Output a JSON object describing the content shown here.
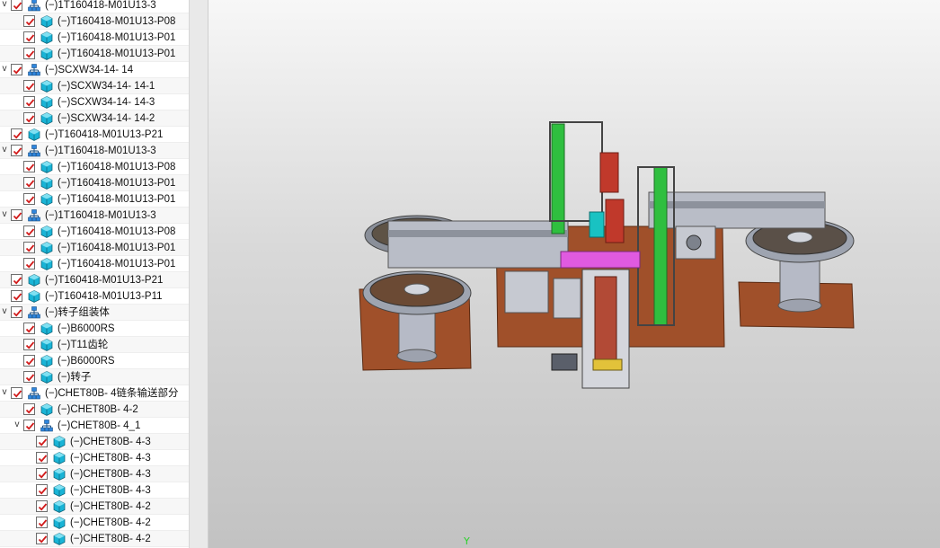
{
  "tree": {
    "rows": [
      {
        "label": "(−)1T160418-M01U13-3",
        "kind": "assembly",
        "level": 1,
        "expander": "v"
      },
      {
        "label": "(−)T160418-M01U13-P08",
        "kind": "part",
        "level": 2
      },
      {
        "label": "(−)T160418-M01U13-P01",
        "kind": "part",
        "level": 2
      },
      {
        "label": "(−)T160418-M01U13-P01",
        "kind": "part",
        "level": 2
      },
      {
        "label": "(−)SCXW34-14- 14",
        "kind": "assembly",
        "level": 1,
        "expander": "v"
      },
      {
        "label": "(−)SCXW34-14- 14-1",
        "kind": "part",
        "level": 2
      },
      {
        "label": "(−)SCXW34-14- 14-3",
        "kind": "part",
        "level": 2
      },
      {
        "label": "(−)SCXW34-14- 14-2",
        "kind": "part",
        "level": 2
      },
      {
        "label": "(−)T160418-M01U13-P21",
        "kind": "part",
        "level": 1
      },
      {
        "label": "(−)1T160418-M01U13-3",
        "kind": "assembly",
        "level": 1,
        "expander": "v"
      },
      {
        "label": "(−)T160418-M01U13-P08",
        "kind": "part",
        "level": 2
      },
      {
        "label": "(−)T160418-M01U13-P01",
        "kind": "part",
        "level": 2
      },
      {
        "label": "(−)T160418-M01U13-P01",
        "kind": "part",
        "level": 2
      },
      {
        "label": "(−)1T160418-M01U13-3",
        "kind": "assembly",
        "level": 1,
        "expander": "v"
      },
      {
        "label": "(−)T160418-M01U13-P08",
        "kind": "part",
        "level": 2
      },
      {
        "label": "(−)T160418-M01U13-P01",
        "kind": "part",
        "level": 2
      },
      {
        "label": "(−)T160418-M01U13-P01",
        "kind": "part",
        "level": 2
      },
      {
        "label": "(−)T160418-M01U13-P21",
        "kind": "part",
        "level": 1
      },
      {
        "label": "(−)T160418-M01U13-P11",
        "kind": "part",
        "level": 1
      },
      {
        "label": "(−)转子组装体",
        "kind": "assembly",
        "level": 1,
        "expander": "v"
      },
      {
        "label": "(−)B6000RS",
        "kind": "part",
        "level": 2
      },
      {
        "label": "(−)T11齿轮",
        "kind": "part",
        "level": 2
      },
      {
        "label": "(−)B6000RS",
        "kind": "part",
        "level": 2
      },
      {
        "label": "(−)转子",
        "kind": "part",
        "level": 2
      },
      {
        "label": "(−)CHET80B- 4链条输送部分",
        "kind": "assembly",
        "level": 1,
        "expander": "v"
      },
      {
        "label": "(−)CHET80B- 4-2",
        "kind": "part",
        "level": 2
      },
      {
        "label": "(−)CHET80B- 4_1",
        "kind": "assembly",
        "level": 2,
        "expander": "v"
      },
      {
        "label": "(−)CHET80B- 4-3",
        "kind": "part",
        "level": 3
      },
      {
        "label": "(−)CHET80B- 4-3",
        "kind": "part",
        "level": 3
      },
      {
        "label": "(−)CHET80B- 4-3",
        "kind": "part",
        "level": 3
      },
      {
        "label": "(−)CHET80B- 4-3",
        "kind": "part",
        "level": 3
      },
      {
        "label": "(−)CHET80B- 4-2",
        "kind": "part",
        "level": 3
      },
      {
        "label": "(−)CHET80B- 4-2",
        "kind": "part",
        "level": 3
      },
      {
        "label": "(−)CHET80B- 4-2",
        "kind": "part",
        "level": 3
      }
    ]
  },
  "viewport": {
    "axis_label": "Y",
    "colors": {
      "plate": "#a0502a",
      "steel": "#9fa6b4",
      "green": "#2fbf3f",
      "magenta": "#e05ae0",
      "red": "#c0392b",
      "cyan": "#19c2c2"
    }
  },
  "icons": {
    "assembly": "assembly-icon",
    "part": "part-icon",
    "checkbox": "checkmark-icon"
  }
}
